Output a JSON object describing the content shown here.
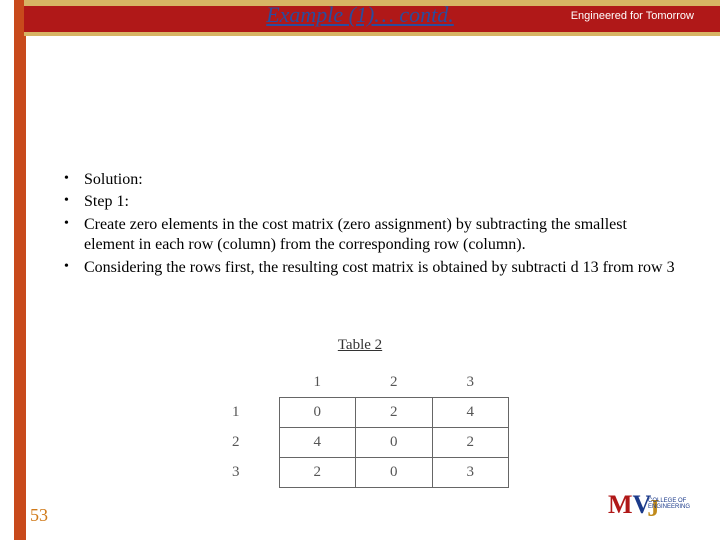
{
  "header": {
    "title": "Example (1)… contd.",
    "tagline": "Engineered for Tomorrow"
  },
  "bullets": [
    "Solution:",
    "Step 1:",
    "Create zero elements in the cost matrix (zero assignment) by subtracting the smallest element in each row (column) from the corresponding row (column).",
    "Considering the rows first, the resulting cost matrix is obtained by subtracti                                                               d 13 from row 3"
  ],
  "table": {
    "label": "Table 2",
    "col_headers": [
      "1",
      "2",
      "3"
    ],
    "row_headers": [
      "1",
      "2",
      "3"
    ],
    "rows": [
      [
        "0",
        "2",
        "4"
      ],
      [
        "4",
        "0",
        "2"
      ],
      [
        "2",
        "0",
        "3"
      ]
    ]
  },
  "footer": {
    "page": "53",
    "logo_sub": "COLLEGE OF ENGINEERING"
  },
  "chart_data": {
    "type": "table",
    "title": "Table 2",
    "columns": [
      "1",
      "2",
      "3"
    ],
    "rows": [
      "1",
      "2",
      "3"
    ],
    "values": [
      [
        0,
        2,
        4
      ],
      [
        4,
        0,
        2
      ],
      [
        2,
        0,
        3
      ]
    ]
  }
}
